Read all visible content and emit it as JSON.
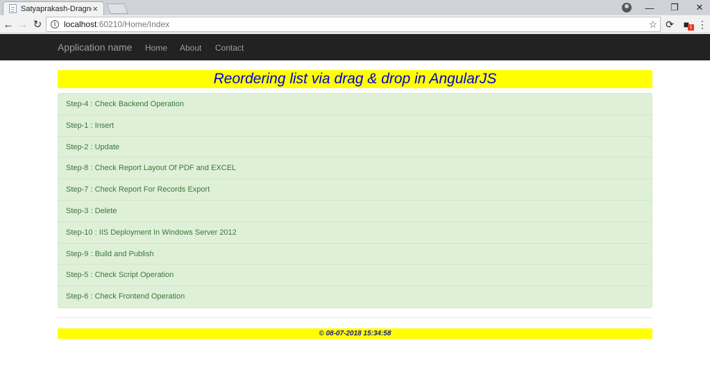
{
  "browser": {
    "tab_title": "Satyaprakash-DragndDro",
    "tab_close": "×",
    "url_host": "localhost",
    "url_path": ":60210/Home/Index",
    "extension_badge": "1"
  },
  "navbar": {
    "brand": "Application name",
    "links": [
      "Home",
      "About",
      "Contact"
    ]
  },
  "page": {
    "heading": "Reordering list via drag & drop in AngularJS",
    "items": [
      "Step-4 : Check Backend Operation",
      "Step-1 : Insert",
      "Step-2 : Update",
      "Step-8 : Check Report Layout Of PDF and EXCEL",
      "Step-7 : Check Report For Records Export",
      "Step-3 : Delete",
      "Step-10 : IIS Deployment In Windows Server 2012",
      "Step-9 : Build and Publish",
      "Step-5 : Check Script Operation",
      "Step-6 : Check Frontend Operation"
    ],
    "footer": "© 08-07-2018 15:34:58"
  },
  "colors": {
    "heading_bg": "#ffff00",
    "heading_text": "#0000cc",
    "list_bg": "#dff0d8",
    "list_text": "#3c763d",
    "navbar_bg": "#222222"
  }
}
